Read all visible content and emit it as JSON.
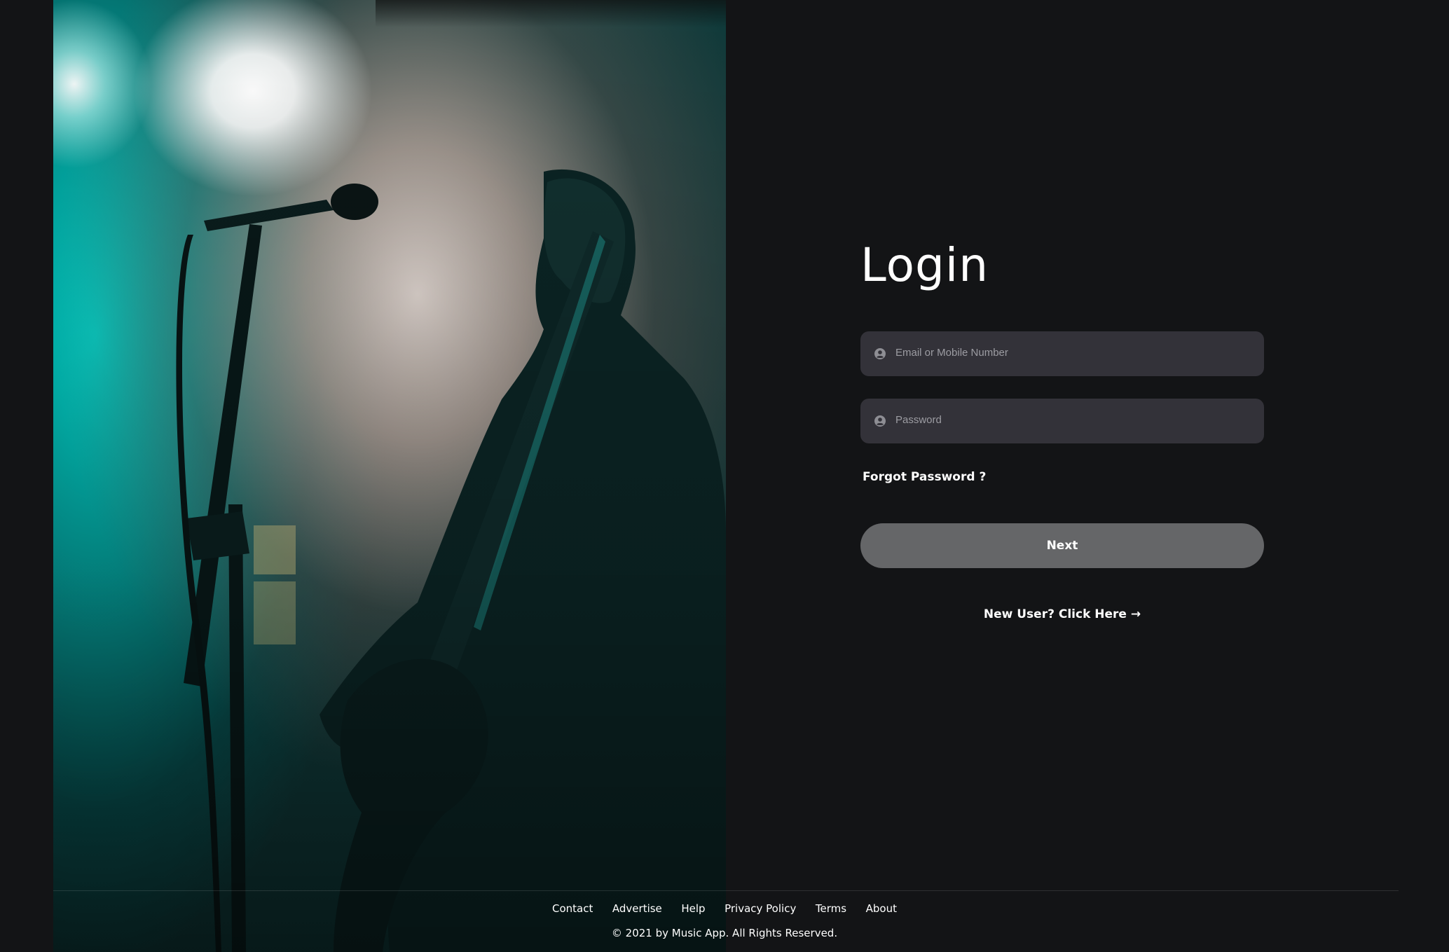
{
  "login": {
    "title": "Login",
    "email_placeholder": "Email or Mobile Number",
    "password_placeholder": "Password",
    "forgot_label": "Forgot Password ?",
    "next_label": "Next",
    "new_user_label": "New User? Click Here →"
  },
  "footer": {
    "links": [
      "Contact",
      "Advertise",
      "Help",
      "Privacy Policy",
      "Terms",
      "About"
    ],
    "copyright": "© 2021 by Music App. All Rights Reserved."
  },
  "colors": {
    "background": "#131416",
    "input_bg": "#333239",
    "button_bg": "#656668",
    "text": "#ffffff",
    "accent_teal": "#00c8c0"
  },
  "icons": {
    "field_icon": "user-circle-icon"
  },
  "hero": {
    "subject": "guitarist-silhouette-photo"
  }
}
